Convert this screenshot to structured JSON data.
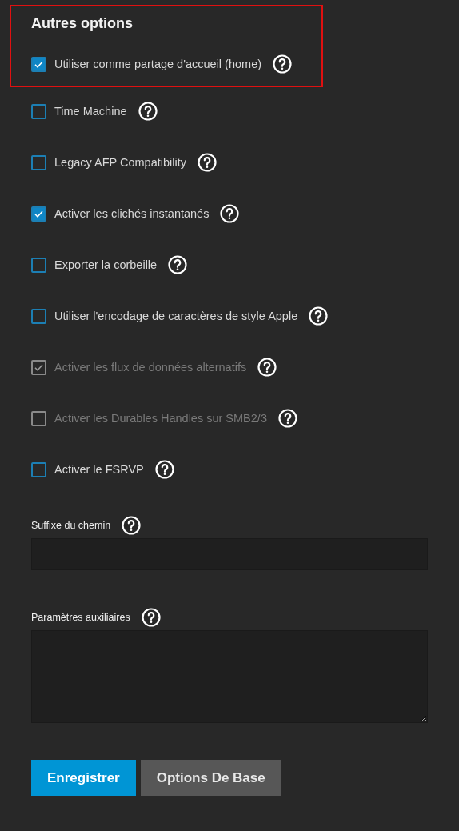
{
  "section": {
    "title": "Autres options",
    "highlighted": true
  },
  "options": [
    {
      "label": "Utiliser comme partage d'accueil (home)",
      "checked": true,
      "disabled": false
    },
    {
      "label": "Time Machine",
      "checked": false,
      "disabled": false
    },
    {
      "label": "Legacy AFP Compatibility",
      "checked": false,
      "disabled": false
    },
    {
      "label": "Activer les clichés instantanés",
      "checked": true,
      "disabled": false
    },
    {
      "label": "Exporter la corbeille",
      "checked": false,
      "disabled": false
    },
    {
      "label": "Utiliser l'encodage de caractères de style Apple",
      "checked": false,
      "disabled": false
    },
    {
      "label": "Activer les flux de données alternatifs",
      "checked": true,
      "disabled": true
    },
    {
      "label": "Activer les Durables Handles sur SMB2/3",
      "checked": false,
      "disabled": true
    },
    {
      "label": "Activer le FSRVP",
      "checked": false,
      "disabled": false
    }
  ],
  "fields": [
    {
      "label": "Suffixe du chemin",
      "kind": "input"
    },
    {
      "label": "Paramètres auxiliaires",
      "kind": "textarea"
    }
  ],
  "buttons": [
    {
      "label": "Enregistrer",
      "kind": "primary"
    },
    {
      "label": "Options De Base",
      "kind": "secondary"
    }
  ]
}
